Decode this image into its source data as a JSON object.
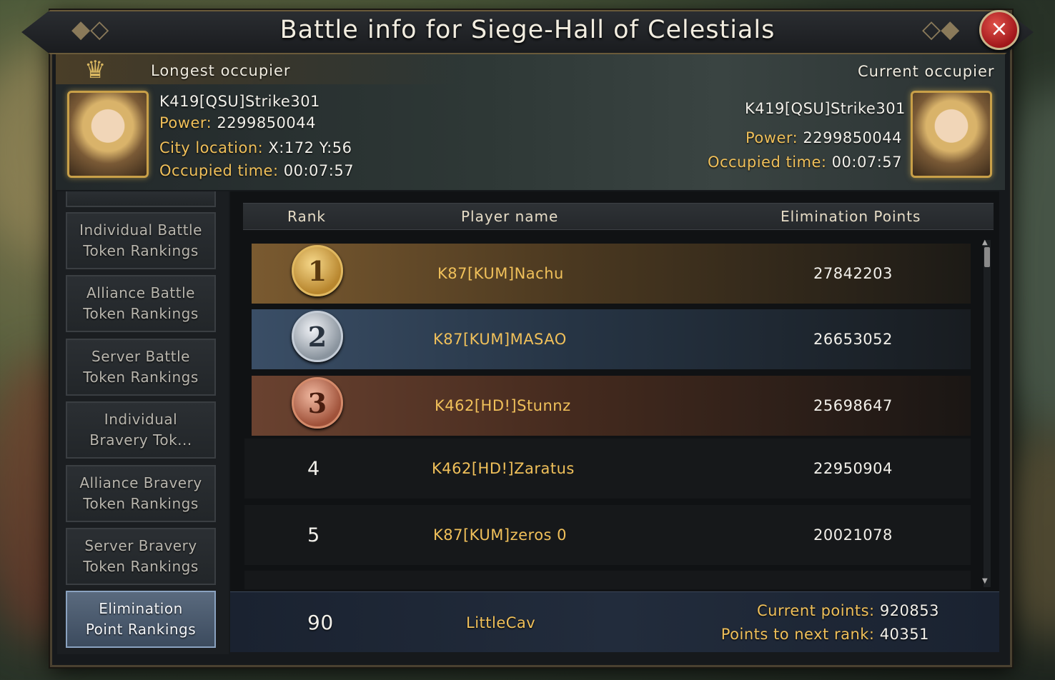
{
  "window": {
    "title": "Battle info for Siege-Hall of Celestials",
    "close_icon": "×"
  },
  "longest_occupier": {
    "label": "Longest occupier",
    "name": "K419[QSU]Strike301",
    "power_label": "Power:",
    "power": "2299850044",
    "city_label": "City location:",
    "city": "X:172 Y:56",
    "time_label": "Occupied time:",
    "time": "00:07:57"
  },
  "current_occupier": {
    "label": "Current occupier",
    "name": "K419[QSU]Strike301",
    "power_label": "Power:",
    "power": "2299850044",
    "time_label": "Occupied time:",
    "time": "00:07:57"
  },
  "sidebar": {
    "items": [
      {
        "label": "Individual Battle\nToken Rankings",
        "active": false
      },
      {
        "label": "Alliance Battle\nToken Rankings",
        "active": false
      },
      {
        "label": "Server Battle\nToken Rankings",
        "active": false
      },
      {
        "label": "Individual\nBravery Tok...",
        "active": false
      },
      {
        "label": "Alliance Bravery\nToken Rankings",
        "active": false
      },
      {
        "label": "Server Bravery\nToken Rankings",
        "active": false
      },
      {
        "label": "Elimination\nPoint Rankings",
        "active": true
      }
    ]
  },
  "table": {
    "headers": {
      "rank": "Rank",
      "player": "Player name",
      "points": "Elimination Points"
    },
    "rows": [
      {
        "rank": "1",
        "player": "K87[KUM]Nachu",
        "points": "27842203"
      },
      {
        "rank": "2",
        "player": "K87[KUM]MASAO",
        "points": "26653052"
      },
      {
        "rank": "3",
        "player": "K462[HD!]Stunnz",
        "points": "25698647"
      },
      {
        "rank": "4",
        "player": "K462[HD!]Zaratus",
        "points": "22950904"
      },
      {
        "rank": "5",
        "player": "K87[KUM]zeros 0",
        "points": "20021078"
      }
    ]
  },
  "my_rank": {
    "rank": "90",
    "player": "LittleCav",
    "current_points_label": "Current points:",
    "current_points": "920853",
    "next_rank_label": "Points to next rank:",
    "next_rank_points": "40351"
  },
  "colors": {
    "gold_text": "#f0c05a",
    "row_gold": "#6a5030",
    "row_silver": "#2e3e50",
    "row_bronze": "#5a3a2a",
    "active_tab": "#4c5c70"
  }
}
